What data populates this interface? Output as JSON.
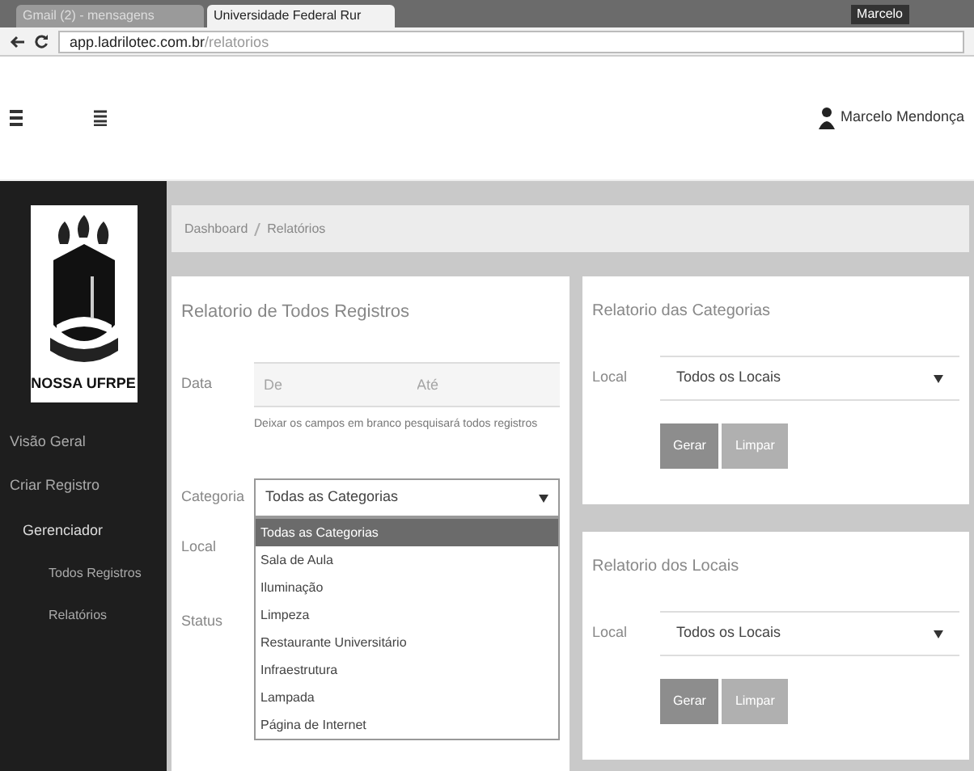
{
  "browser": {
    "tabs": [
      {
        "label": "Gmail (2) - mensagens",
        "selected": false
      },
      {
        "label": "Universidade Federal Rur",
        "selected": true
      }
    ],
    "profile": "Marcelo",
    "url_host": "app.ladrilotec.com.br",
    "url_path": "/relatorios"
  },
  "header": {
    "user": "Marcelo Mendonça"
  },
  "sidebar": {
    "logo_text": "NOSSA UFRPE",
    "items": [
      {
        "label": "Visão Geral",
        "kind": "item"
      },
      {
        "label": "Criar Registro",
        "kind": "item"
      },
      {
        "label": "Gerenciador",
        "kind": "group"
      },
      {
        "label": "Todos Registros",
        "kind": "sub"
      },
      {
        "label": "Relatórios",
        "kind": "sub"
      }
    ]
  },
  "breadcrumb": [
    "Dashboard",
    "Relatórios"
  ],
  "report_all": {
    "title": "Relatorio de Todos Registros",
    "date_label": "Data",
    "from_placeholder": "De",
    "to_placeholder": "Até",
    "hint": "Deixar os campos em branco pesquisará todos registros",
    "category_label": "Categoria",
    "category_value": "Todas as Categorias",
    "local_label": "Local",
    "status_label": "Status",
    "options": [
      {
        "label": "Todas as Categorias",
        "selected": true
      },
      {
        "label": "Sala de Aula",
        "selected": false
      },
      {
        "label": "Iluminação",
        "selected": false
      },
      {
        "label": "Limpeza",
        "selected": false
      },
      {
        "label": "Restaurante Universitário",
        "selected": false
      },
      {
        "label": "Infraestrutura",
        "selected": false
      },
      {
        "label": "Lampada",
        "selected": false
      },
      {
        "label": "Página de Internet",
        "selected": false
      }
    ]
  },
  "side_reports": [
    {
      "title": "Relatorio das Categorias",
      "local_label": "Local",
      "local_value": "Todos os Locais",
      "buttons": [
        "Gerar",
        "Limpar"
      ]
    },
    {
      "title": "Relatorio dos Locais",
      "local_label": "Local",
      "local_value": "Todos os Locais",
      "buttons": [
        "Gerar",
        "Limpar"
      ]
    }
  ]
}
